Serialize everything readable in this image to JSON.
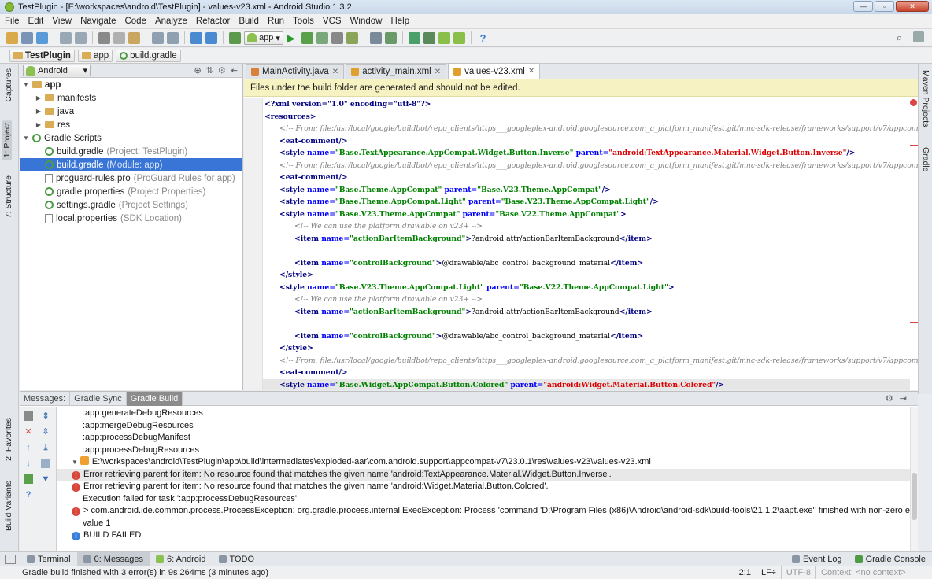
{
  "window": {
    "title": "TestPlugin - [E:\\workspaces\\android\\TestPlugin] - values-v23.xml - Android Studio 1.3.2",
    "minimize": "—",
    "maximize": "▫",
    "close": "✕"
  },
  "menu": [
    "File",
    "Edit",
    "View",
    "Navigate",
    "Code",
    "Analyze",
    "Refactor",
    "Build",
    "Run",
    "Tools",
    "VCS",
    "Window",
    "Help"
  ],
  "toolbar": {
    "run_config": "app"
  },
  "breadcrumb": [
    "TestPlugin",
    "app",
    "build.gradle"
  ],
  "left_tool_tabs": [
    "Captures",
    "1: Project",
    "7: Structure",
    "2: Favorites",
    "Build Variants"
  ],
  "right_tool_tabs": [
    "Maven Projects",
    "Gradle"
  ],
  "project_panel": {
    "view_mode": "Android",
    "tree": [
      {
        "label": "app",
        "hint": "",
        "depth": 0,
        "expanded": true,
        "icon": "folder-icon"
      },
      {
        "label": "manifests",
        "hint": "",
        "depth": 1,
        "expanded": false,
        "icon": "folder-icon"
      },
      {
        "label": "java",
        "hint": "",
        "depth": 1,
        "expanded": false,
        "icon": "folder-icon"
      },
      {
        "label": "res",
        "hint": "",
        "depth": 1,
        "expanded": false,
        "icon": "folder-icon"
      },
      {
        "label": "Gradle Scripts",
        "hint": "",
        "depth": 0,
        "expanded": true,
        "icon": "gradle-icon"
      },
      {
        "label": "build.gradle",
        "hint": "(Project: TestPlugin)",
        "depth": 1,
        "icon": "gradle-icon"
      },
      {
        "label": "build.gradle",
        "hint": "(Module: app)",
        "depth": 1,
        "icon": "gradle-icon",
        "selected": true
      },
      {
        "label": "proguard-rules.pro",
        "hint": "(ProGuard Rules for app)",
        "depth": 1,
        "icon": "file-icon"
      },
      {
        "label": "gradle.properties",
        "hint": "(Project Properties)",
        "depth": 1,
        "icon": "gradle-icon"
      },
      {
        "label": "settings.gradle",
        "hint": "(Project Settings)",
        "depth": 1,
        "icon": "gradle-icon"
      },
      {
        "label": "local.properties",
        "hint": "(SDK Location)",
        "depth": 1,
        "icon": "file-icon"
      }
    ]
  },
  "editor": {
    "tabs": [
      {
        "label": "MainActivity.java",
        "active": false
      },
      {
        "label": "activity_main.xml",
        "active": false
      },
      {
        "label": "values-v23.xml",
        "active": true
      }
    ],
    "banner": "Files under the build folder are generated and should not be edited.",
    "lines": [
      {
        "indent": 0,
        "kind": "decl",
        "text": "<?xml version=\"1.0\" encoding=\"utf-8\"?>"
      },
      {
        "indent": 0,
        "kind": "tag",
        "text": "<resources>"
      },
      {
        "indent": 1,
        "kind": "comment",
        "text": "<!-- From: file:/usr/local/google/buildbot/repo_clients/https___googleplex-android.googlesource.com_a_platform_manifest.git/mnc-sdk-release/frameworks/support/v7/appcompat/res/values-v23/styles_base_text.xml -->"
      },
      {
        "indent": 1,
        "kind": "tag",
        "text": "<eat-comment/>"
      },
      {
        "indent": 1,
        "kind": "style",
        "name": "Base.TextAppearance.AppCompat.Widget.Button.Inverse",
        "parent": "android:TextAppearance.Material.Widget.Button.Inverse",
        "close": "/>",
        "parent_error": true
      },
      {
        "indent": 1,
        "kind": "comment",
        "text": "<!-- From: file:/usr/local/google/buildbot/repo_clients/https___googleplex-android.googlesource.com_a_platform_manifest.git/mnc-sdk-release/frameworks/support/v7/appcompat/res/values-v23/styles_base.xml -->"
      },
      {
        "indent": 1,
        "kind": "tag",
        "text": "<eat-comment/>"
      },
      {
        "indent": 1,
        "kind": "style",
        "name": "Base.Theme.AppCompat",
        "parent": "Base.V23.Theme.AppCompat",
        "close": "/>"
      },
      {
        "indent": 1,
        "kind": "style",
        "name": "Base.Theme.AppCompat.Light",
        "parent": "Base.V23.Theme.AppCompat.Light",
        "close": "/>"
      },
      {
        "indent": 1,
        "kind": "style",
        "name": "Base.V23.Theme.AppCompat",
        "parent": "Base.V22.Theme.AppCompat",
        "close": ">"
      },
      {
        "indent": 2,
        "kind": "comment",
        "text": "<!-- We can use the platform drawable on v23+ -->"
      },
      {
        "indent": 2,
        "kind": "item",
        "name": "actionBarItemBackground",
        "value": "?android:attr/actionBarItemBackground"
      },
      {
        "indent": 2,
        "kind": "blank",
        "text": ""
      },
      {
        "indent": 2,
        "kind": "item",
        "name": "controlBackground",
        "value": "@drawable/abc_control_background_material"
      },
      {
        "indent": 1,
        "kind": "tag",
        "text": "</style>"
      },
      {
        "indent": 1,
        "kind": "style",
        "name": "Base.V23.Theme.AppCompat.Light",
        "parent": "Base.V22.Theme.AppCompat.Light",
        "close": ">"
      },
      {
        "indent": 2,
        "kind": "comment",
        "text": "<!-- We can use the platform drawable on v23+ -->"
      },
      {
        "indent": 2,
        "kind": "item",
        "name": "actionBarItemBackground",
        "value": "?android:attr/actionBarItemBackground"
      },
      {
        "indent": 2,
        "kind": "blank",
        "text": ""
      },
      {
        "indent": 2,
        "kind": "item",
        "name": "controlBackground",
        "value": "@drawable/abc_control_background_material"
      },
      {
        "indent": 1,
        "kind": "tag",
        "text": "</style>"
      },
      {
        "indent": 1,
        "kind": "comment",
        "text": "<!-- From: file:/usr/local/google/buildbot/repo_clients/https___googleplex-android.googlesource.com_a_platform_manifest.git/mnc-sdk-release/frameworks/support/v7/appcompat/res/values-v23/styles_base.xml -->"
      },
      {
        "indent": 1,
        "kind": "tag",
        "text": "<eat-comment/>"
      },
      {
        "indent": 1,
        "kind": "style",
        "name": "Base.Widget.AppCompat.Button.Colored",
        "parent": "android:Widget.Material.Button.Colored",
        "close": "/>",
        "parent_error": true,
        "caret": true
      }
    ]
  },
  "bottom_panel": {
    "tabs": [
      {
        "label": "Messages:",
        "active": false
      },
      {
        "label": "Gradle Sync",
        "active": false
      },
      {
        "label": "Gradle Build",
        "active": true
      }
    ],
    "messages": [
      {
        "kind": "plain",
        "text": ":app:generateDebugResources",
        "indent": 1
      },
      {
        "kind": "plain",
        "text": ":app:mergeDebugResources",
        "indent": 1
      },
      {
        "kind": "plain",
        "text": ":app:processDebugManifest",
        "indent": 1
      },
      {
        "kind": "plain",
        "text": ":app:processDebugResources",
        "indent": 1
      },
      {
        "kind": "file",
        "text": "E:\\workspaces\\android\\TestPlugin\\app\\build\\intermediates\\exploded-aar\\com.android.support\\appcompat-v7\\23.0.1\\res\\values-v23\\values-v23.xml",
        "indent": 0
      },
      {
        "kind": "error",
        "text": "Error retrieving parent for item: No resource found that matches the given name 'android:TextAppearance.Material.Widget.Button.Inverse'.",
        "indent": 2,
        "highlight": true
      },
      {
        "kind": "error",
        "text": "Error retrieving parent for item: No resource found that matches the given name 'android:Widget.Material.Button.Colored'.",
        "indent": 2
      },
      {
        "kind": "plain",
        "text": "Execution failed for task ':app:processDebugResources'.",
        "indent": 1
      },
      {
        "kind": "error",
        "text": "> com.android.ide.common.process.ProcessException: org.gradle.process.internal.ExecException: Process 'command 'D:\\Program Files (x86)\\Android\\android-sdk\\build-tools\\21.1.2\\aapt.exe'' finished with non-zero exit",
        "indent": 0
      },
      {
        "kind": "plain",
        "text": "value 1",
        "indent": 1
      },
      {
        "kind": "info",
        "text": "BUILD FAILED",
        "indent": 0
      }
    ]
  },
  "tool_windows": [
    {
      "label": "Terminal",
      "active": false
    },
    {
      "label": "0: Messages",
      "active": true
    },
    {
      "label": "6: Android",
      "active": false
    },
    {
      "label": "TODO",
      "active": false
    }
  ],
  "tool_windows_right": [
    "Event Log",
    "Gradle Console"
  ],
  "status": {
    "message": "Gradle build finished with 3 error(s) in 9s 264ms (3 minutes ago)",
    "position": "2:1",
    "line_sep": "LF÷",
    "encoding": "UTF-8",
    "context": "Context: <no context>"
  }
}
